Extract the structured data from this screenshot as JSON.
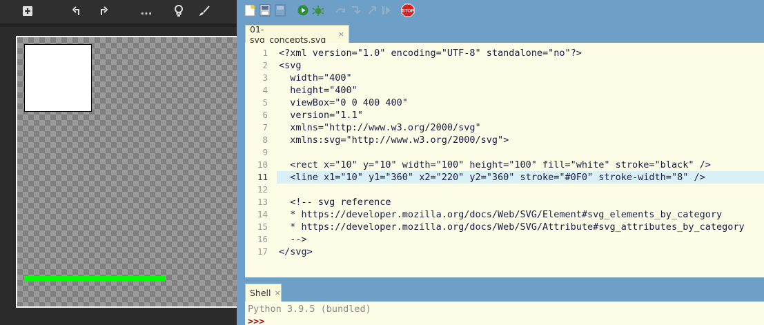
{
  "viewer": {
    "toolbar": {
      "add_icon": "plus-square-icon",
      "rotate_left_icon": "rotate-left-icon",
      "rotate_right_icon": "rotate-right-icon",
      "more_label": "...",
      "hint_icon": "lightbulb-icon",
      "brush_icon": "brush-icon"
    },
    "canvas": {
      "rect_fill": "#ffffff",
      "rect_stroke": "#000000",
      "line_stroke": "#00ff00"
    }
  },
  "ide": {
    "toolbar": {
      "buttons": [
        "new-file",
        "open-file",
        "save-file",
        "run",
        "debug",
        "step-over",
        "step-into",
        "step-out",
        "resume",
        "stop"
      ],
      "stop_label": "STOP"
    },
    "editor_tab": {
      "label": "01-svg_concepts.svg",
      "close": "×"
    },
    "editor": {
      "current_line": 11,
      "line_numbers": [
        "1",
        "2",
        "3",
        "4",
        "5",
        "6",
        "7",
        "8",
        "9",
        "10",
        "11",
        "12",
        "13",
        "14",
        "15",
        "16",
        "17"
      ],
      "lines": [
        "<?xml version=\"1.0\" encoding=\"UTF-8\" standalone=\"no\"?>",
        "<svg",
        "  width=\"400\"",
        "  height=\"400\"",
        "  viewBox=\"0 0 400 400\"",
        "  version=\"1.1\"",
        "  xmlns=\"http://www.w3.org/2000/svg\"",
        "  xmlns:svg=\"http://www.w3.org/2000/svg\">",
        "",
        "  <rect x=\"10\" y=\"10\" width=\"100\" height=\"100\" fill=\"white\" stroke=\"black\" />",
        "  <line x1=\"10\" y1=\"360\" x2=\"220\" y2=\"360\" stroke=\"#0F0\" stroke-width=\"8\" />",
        "",
        "  <!-- svg reference",
        "  * https://developer.mozilla.org/docs/Web/SVG/Element#svg_elements_by_category",
        "  * https://developer.mozilla.org/docs/Web/SVG/Attribute#svg_attributes_by_category",
        "  -->",
        "</svg>"
      ]
    },
    "shell_tab": {
      "label": "Shell",
      "close": "×"
    },
    "shell": {
      "banner": "Python 3.9.5 (bundled)",
      "prompt": ">>>"
    }
  }
}
